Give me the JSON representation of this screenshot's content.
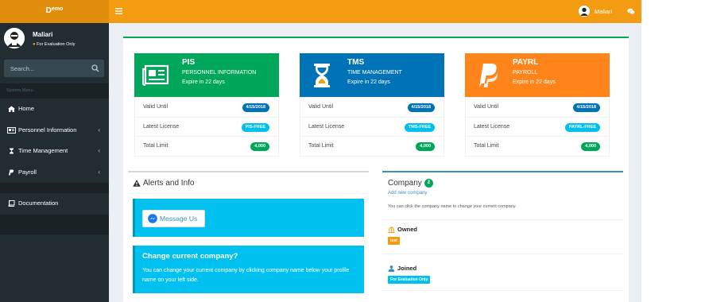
{
  "logo": {
    "first": "D",
    "rest": "emo"
  },
  "user": {
    "name": "Maliari",
    "status": "For Evaluation Only"
  },
  "search": {
    "placeholder": "Search..."
  },
  "sidebar": {
    "header": "System Menu",
    "items": [
      {
        "label": "Home",
        "icon": "home-icon",
        "has_children": false
      },
      {
        "label": "Personnel Information",
        "icon": "id-card-icon",
        "has_children": true
      },
      {
        "label": "Time Management",
        "icon": "hourglass-icon",
        "has_children": true
      },
      {
        "label": "Payroll",
        "icon": "paypal-icon",
        "has_children": true
      }
    ],
    "documentation": "Documentation",
    "chevron": "‹"
  },
  "topbar": {
    "user_name": "Maliari"
  },
  "products": [
    {
      "code": "PIS",
      "name": "PERSONNEL INFORMATION",
      "expire": "Expire in 22 days",
      "color": "#00a65a",
      "icon": "newspaper-icon",
      "rows": [
        {
          "label": "Valid Until",
          "value": "4/15/2018"
        },
        {
          "label": "Latest License",
          "value": "PIS-FREE"
        },
        {
          "label": "Total Limit",
          "value": "4,000"
        }
      ]
    },
    {
      "code": "TMS",
      "name": "TIME MANAGEMENT",
      "expire": "Expire in 22 days",
      "color": "#0073b7",
      "icon": "hourglass-icon",
      "rows": [
        {
          "label": "Valid Until",
          "value": "4/15/2018"
        },
        {
          "label": "Latest License",
          "value": "TMS-FREE"
        },
        {
          "label": "Total Limit",
          "value": "4,000"
        }
      ]
    },
    {
      "code": "PAYRL",
      "name": "PAYROLL",
      "expire": "Expire in 22 days",
      "color": "#ff851b",
      "icon": "paypal-icon",
      "rows": [
        {
          "label": "Valid Until",
          "value": "4/15/2018"
        },
        {
          "label": "Latest License",
          "value": "PAYRL-FREE"
        },
        {
          "label": "Total Limit",
          "value": "4,000"
        }
      ]
    }
  ],
  "alerts": {
    "title": "Alerts and Info",
    "message_button": "Message Us",
    "change_title": "Change current company?",
    "change_text": "You can change your current company by clicking company name below your profile name on your left side."
  },
  "company": {
    "title": "Company",
    "count": "2",
    "add_link": "Add new company",
    "help": "You can click the company name to change your current company.",
    "owned_label": "Owned",
    "owned_tag": "test",
    "joined_label": "Joined",
    "joined_tag": "For Evaluation Only"
  }
}
